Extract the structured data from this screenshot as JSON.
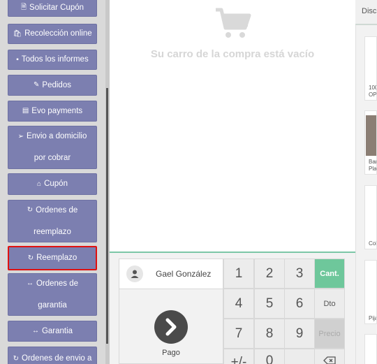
{
  "sidebar": {
    "buttons": [
      {
        "icon": "🗎",
        "label": "Solicitar Cupón",
        "label2": ""
      },
      {
        "icon": "🛍",
        "label": "Recolección online",
        "label2": ""
      },
      {
        "icon": "▪",
        "label": "Todos los informes",
        "label2": ""
      },
      {
        "icon": "✎",
        "label": "Pedidos",
        "label2": ""
      },
      {
        "icon": "▤",
        "label": "Evo payments",
        "label2": ""
      },
      {
        "icon": "➢",
        "label": "Envio a domicilio",
        "label2": "por cobrar"
      },
      {
        "icon": "⌂",
        "label": "Cupón",
        "label2": ""
      },
      {
        "icon": "↻",
        "label": "Ordenes de",
        "label2": "reemplazo"
      },
      {
        "icon": "↻",
        "label": "Reemplazo",
        "label2": ""
      },
      {
        "icon": "↔",
        "label": "Ordenes de",
        "label2": "garantia"
      },
      {
        "icon": "↔",
        "label": "Garantia",
        "label2": ""
      },
      {
        "icon": "↻",
        "label": "Ordenes de envio a",
        "label2": ""
      }
    ]
  },
  "cart": {
    "empty_text": "Su carro de la compra está vacío"
  },
  "customer": {
    "name": "Gael González"
  },
  "payment": {
    "label": "Pago"
  },
  "numpad": {
    "keys": [
      "1",
      "2",
      "3",
      "4",
      "5",
      "6",
      "7",
      "8",
      "9",
      "+/-",
      "0"
    ],
    "modes": {
      "qty": "Cant.",
      "disc": "Dto",
      "price": "Precio"
    }
  },
  "products": {
    "tab": "Disc",
    "items": [
      {
        "line1": "100",
        "line2": "OP"
      },
      {
        "line1": "Bar",
        "line2": "Plac"
      },
      {
        "line1": "Col",
        "line2": ""
      },
      {
        "line1": "Pija",
        "line2": ""
      }
    ]
  },
  "colors": {
    "sidebar_button": "#7c7fb0",
    "selected_outline": "#e01010",
    "qty_active": "#6ec79b"
  }
}
